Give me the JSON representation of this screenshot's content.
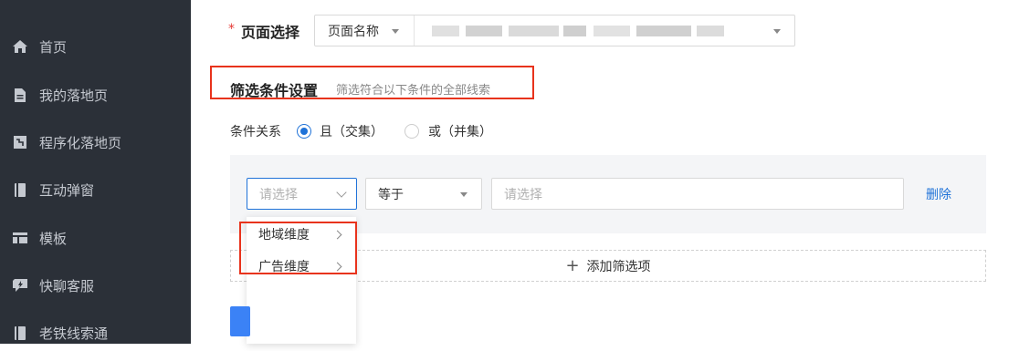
{
  "sidebar": {
    "items": [
      {
        "label": "首页",
        "icon": "home-icon"
      },
      {
        "label": "我的落地页",
        "icon": "document-icon"
      },
      {
        "label": "程序化落地页",
        "icon": "program-icon"
      },
      {
        "label": "互动弹窗",
        "icon": "popup-icon"
      },
      {
        "label": "模板",
        "icon": "template-icon"
      },
      {
        "label": "快聊客服",
        "icon": "chat-icon"
      },
      {
        "label": "老铁线索通",
        "icon": "clue-icon"
      }
    ]
  },
  "page_select": {
    "required_mark": "*",
    "label": "页面选择",
    "type_value": "页面名称"
  },
  "filter_section": {
    "title": "筛选条件设置",
    "hint": "筛选符合以下条件的全部线索"
  },
  "relation": {
    "label": "条件关系",
    "options": [
      {
        "label": "且（交集）",
        "selected": true
      },
      {
        "label": "或（并集）",
        "selected": false
      }
    ]
  },
  "condition": {
    "field_placeholder": "请选择",
    "operator_value": "等于",
    "value_placeholder": "请选择",
    "delete_label": "删除"
  },
  "dropdown": {
    "items": [
      "地域维度",
      "广告维度"
    ]
  },
  "add_filter_label": "添加筛选项",
  "colors": {
    "sidebar_bg": "#2b3038",
    "accent": "#1f72d8",
    "highlight": "#e8331c"
  }
}
